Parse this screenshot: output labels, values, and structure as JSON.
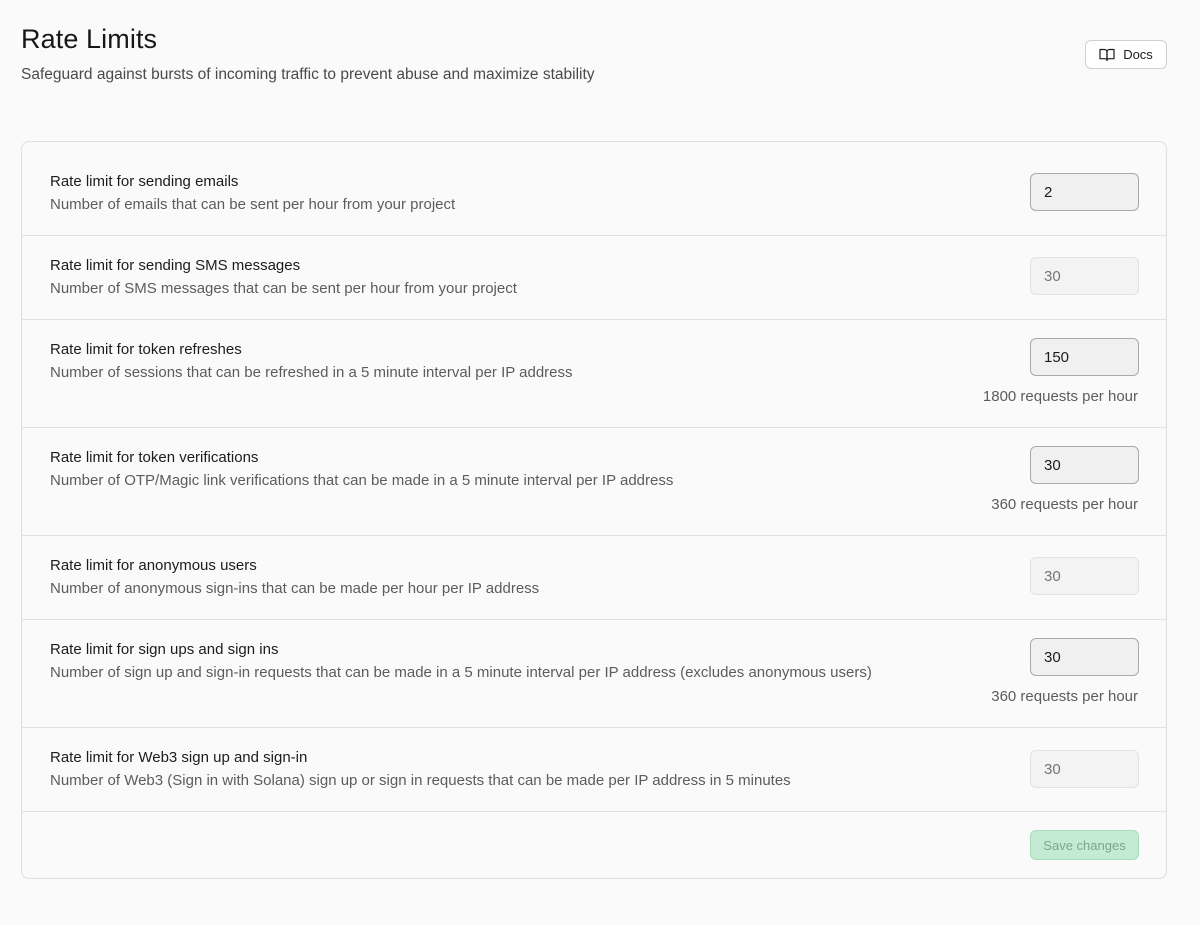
{
  "header": {
    "title": "Rate Limits",
    "subtitle": "Safeguard against bursts of incoming traffic to prevent abuse and maximize stability",
    "docs_label": "Docs",
    "docs_icon": "book-icon"
  },
  "rows": [
    {
      "title": "Rate limit for sending emails",
      "description": "Number of emails that can be sent per hour from your project",
      "value": "2",
      "placeholder": "",
      "disabled": false,
      "per_hour": ""
    },
    {
      "title": "Rate limit for sending SMS messages",
      "description": "Number of SMS messages that can be sent per hour from your project",
      "value": "",
      "placeholder": "30",
      "disabled": true,
      "per_hour": ""
    },
    {
      "title": "Rate limit for token refreshes",
      "description": "Number of sessions that can be refreshed in a 5 minute interval per IP address",
      "value": "150",
      "placeholder": "",
      "disabled": false,
      "per_hour": "1800 requests per hour"
    },
    {
      "title": "Rate limit for token verifications",
      "description": "Number of OTP/Magic link verifications that can be made in a 5 minute interval per IP address",
      "value": "30",
      "placeholder": "",
      "disabled": false,
      "per_hour": "360 requests per hour"
    },
    {
      "title": "Rate limit for anonymous users",
      "description": "Number of anonymous sign-ins that can be made per hour per IP address",
      "value": "",
      "placeholder": "30",
      "disabled": true,
      "per_hour": ""
    },
    {
      "title": "Rate limit for sign ups and sign ins",
      "description": "Number of sign up and sign-in requests that can be made in a 5 minute interval per IP address (excludes anonymous users)",
      "value": "30",
      "placeholder": "",
      "disabled": false,
      "per_hour": "360 requests per hour"
    },
    {
      "title": "Rate limit for Web3 sign up and sign-in",
      "description": "Number of Web3 (Sign in with Solana) sign up or sign in requests that can be made per IP address in 5 minutes",
      "value": "",
      "placeholder": "30",
      "disabled": true,
      "per_hour": ""
    }
  ],
  "footer": {
    "save_label": "Save changes"
  },
  "colors": {
    "save_button_bg": "#c3ebd3",
    "save_button_text": "#7aa78c"
  }
}
